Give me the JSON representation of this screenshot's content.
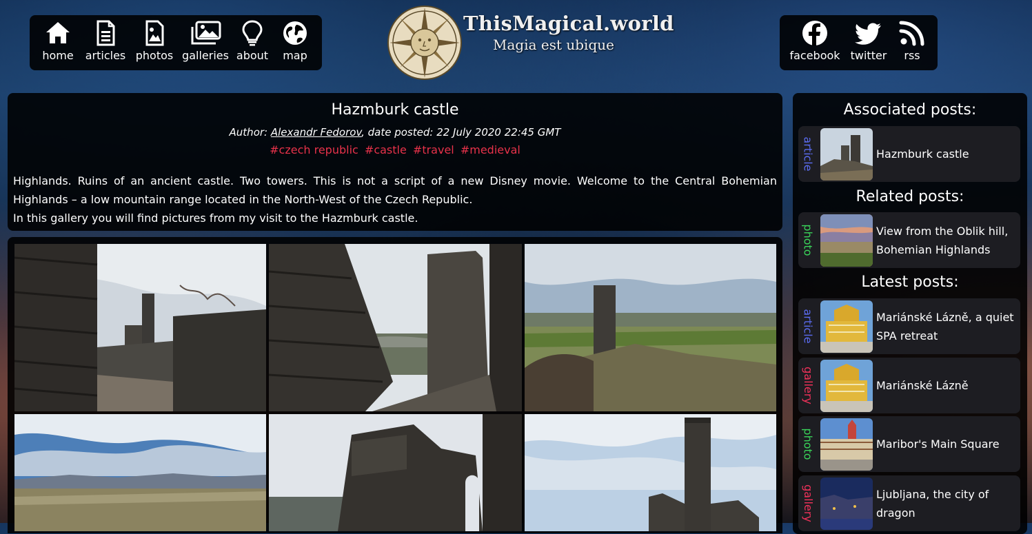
{
  "nav": {
    "items": [
      {
        "label": "home",
        "icon": "home-icon"
      },
      {
        "label": "articles",
        "icon": "document-icon"
      },
      {
        "label": "photos",
        "icon": "photo-icon"
      },
      {
        "label": "galleries",
        "icon": "gallery-icon"
      },
      {
        "label": "about",
        "icon": "lightbulb-icon"
      },
      {
        "label": "map",
        "icon": "globe-icon"
      }
    ]
  },
  "social": {
    "items": [
      {
        "label": "facebook",
        "icon": "facebook-icon"
      },
      {
        "label": "twitter",
        "icon": "twitter-icon"
      },
      {
        "label": "rss",
        "icon": "rss-icon"
      }
    ]
  },
  "logo": {
    "title": "ThisMagical.world",
    "subtitle": "Magia est ubique"
  },
  "post": {
    "title": "Hazmburk castle",
    "author_prefix": "Author: ",
    "author": "Alexandr Fedorov",
    "date_text": ", date posted: 22 July 2020 22:45 GMT",
    "tags": [
      "#czech republic",
      "#castle",
      "#travel",
      "#medieval"
    ],
    "paragraph1": "Highlands. Ruins of an ancient castle. Two towers. This is not a script of a new Disney movie. Welcome to the Central Bohemian Highlands – a low mountain range located in the North-West of the Czech Republic.",
    "paragraph2": "In this gallery you will find pictures from my visit to the Hazmburk castle."
  },
  "sidebar": {
    "associated_heading": "Associated posts:",
    "related_heading": "Related posts:",
    "latest_heading": "Latest posts:",
    "associated": [
      {
        "type": "article",
        "title": "Hazmburk castle"
      }
    ],
    "related": [
      {
        "type": "photo",
        "title": "View from the Oblik hill, Bohemian Highlands"
      }
    ],
    "latest": [
      {
        "type": "article",
        "title": "Mariánské Lázně, a quiet SPA retreat"
      },
      {
        "type": "gallery",
        "title": "Mariánské Lázně"
      },
      {
        "type": "photo",
        "title": "Maribor's Main Square"
      },
      {
        "type": "gallery",
        "title": "Ljubljana, the city of dragon"
      }
    ]
  },
  "colors": {
    "tag": "#e8324a",
    "article": "#5b6cf0",
    "photo": "#3ad55a",
    "gallery": "#f0325a"
  }
}
